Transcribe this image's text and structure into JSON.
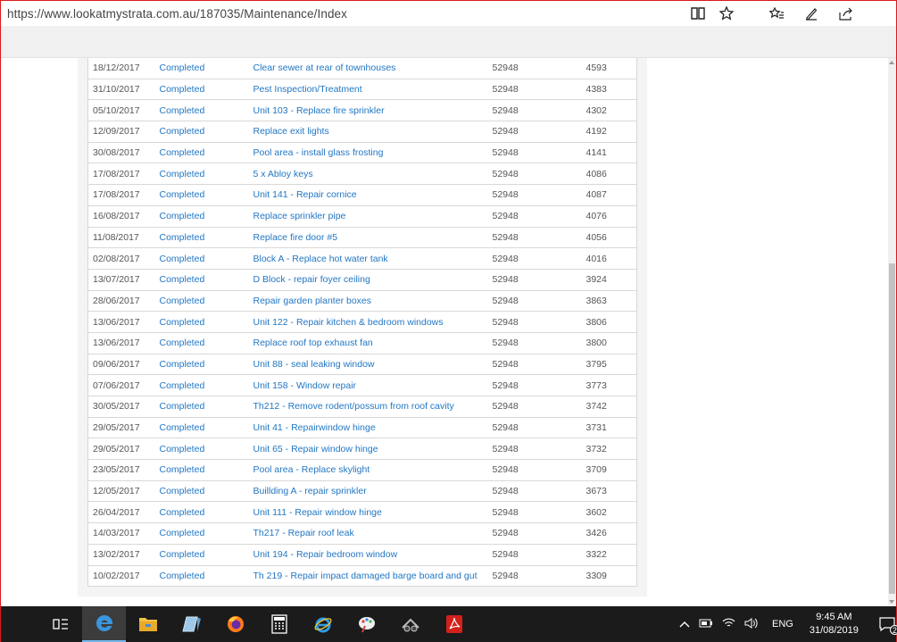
{
  "browser": {
    "url": "https://www.lookatmystrata.com.au/187035/Maintenance/Index",
    "icons": [
      "reading-view-icon",
      "favorite-star-icon",
      "favorites-hub-icon",
      "pen-note-icon",
      "share-icon"
    ]
  },
  "maintenance": {
    "rows": [
      {
        "date": "18/12/2017",
        "status": "Completed",
        "description": "Clear sewer at rear of townhouses",
        "number": "52948",
        "id": "4593"
      },
      {
        "date": "31/10/2017",
        "status": "Completed",
        "description": "Pest Inspection/Treatment",
        "number": "52948",
        "id": "4383"
      },
      {
        "date": "05/10/2017",
        "status": "Completed",
        "description": "Unit 103 - Replace fire sprinkler",
        "number": "52948",
        "id": "4302"
      },
      {
        "date": "12/09/2017",
        "status": "Completed",
        "description": "Replace exit lights",
        "number": "52948",
        "id": "4192"
      },
      {
        "date": "30/08/2017",
        "status": "Completed",
        "description": "Pool area - install glass frosting",
        "number": "52948",
        "id": "4141"
      },
      {
        "date": "17/08/2017",
        "status": "Completed",
        "description": "5 x Abloy keys",
        "number": "52948",
        "id": "4086"
      },
      {
        "date": "17/08/2017",
        "status": "Completed",
        "description": "Unit 141 - Repair cornice",
        "number": "52948",
        "id": "4087"
      },
      {
        "date": "16/08/2017",
        "status": "Completed",
        "description": "Replace sprinkler pipe",
        "number": "52948",
        "id": "4076"
      },
      {
        "date": "11/08/2017",
        "status": "Completed",
        "description": "Replace fire door #5",
        "number": "52948",
        "id": "4056"
      },
      {
        "date": "02/08/2017",
        "status": "Completed",
        "description": "Block A - Replace hot water tank",
        "number": "52948",
        "id": "4016"
      },
      {
        "date": "13/07/2017",
        "status": "Completed",
        "description": "D Block - repair foyer ceiling",
        "number": "52948",
        "id": "3924"
      },
      {
        "date": "28/06/2017",
        "status": "Completed",
        "description": "Repair garden planter boxes",
        "number": "52948",
        "id": "3863"
      },
      {
        "date": "13/06/2017",
        "status": "Completed",
        "description": "Unit 122 - Repair kitchen & bedroom windows",
        "number": "52948",
        "id": "3806"
      },
      {
        "date": "13/06/2017",
        "status": "Completed",
        "description": "Replace roof top exhaust fan",
        "number": "52948",
        "id": "3800"
      },
      {
        "date": "09/06/2017",
        "status": "Completed",
        "description": "Unit 88 - seal leaking window",
        "number": "52948",
        "id": "3795"
      },
      {
        "date": "07/06/2017",
        "status": "Completed",
        "description": "Unit 158 - Window repair",
        "number": "52948",
        "id": "3773"
      },
      {
        "date": "30/05/2017",
        "status": "Completed",
        "description": "Th212 - Remove rodent/possum from roof cavity",
        "number": "52948",
        "id": "3742"
      },
      {
        "date": "29/05/2017",
        "status": "Completed",
        "description": "Unit 41 - Repairwindow hinge",
        "number": "52948",
        "id": "3731"
      },
      {
        "date": "29/05/2017",
        "status": "Completed",
        "description": "Unit 65 - Repair window hinge",
        "number": "52948",
        "id": "3732"
      },
      {
        "date": "23/05/2017",
        "status": "Completed",
        "description": "Pool area - Replace skylight",
        "number": "52948",
        "id": "3709"
      },
      {
        "date": "12/05/2017",
        "status": "Completed",
        "description": "Buillding A - repair sprinkler",
        "number": "52948",
        "id": "3673"
      },
      {
        "date": "26/04/2017",
        "status": "Completed",
        "description": "Unit 111 - Repair window hinge",
        "number": "52948",
        "id": "3602"
      },
      {
        "date": "14/03/2017",
        "status": "Completed",
        "description": "Th217 - Repair roof leak",
        "number": "52948",
        "id": "3426"
      },
      {
        "date": "13/02/2017",
        "status": "Completed",
        "description": "Unit 194 - Repair bedroom window",
        "number": "52948",
        "id": "3322"
      },
      {
        "date": "10/02/2017",
        "status": "Completed",
        "description": "Th 219 - Repair impact damaged barge board and gut",
        "number": "52948",
        "id": "3309"
      }
    ]
  },
  "taskbar": {
    "apps": [
      "task-view-icon",
      "edge-icon",
      "file-explorer-icon",
      "notepad-icon",
      "firefox-icon",
      "calculator-icon",
      "internet-explorer-icon",
      "paint-icon",
      "snipping-tool-icon",
      "acrobat-icon"
    ],
    "language": "ENG",
    "time": "9:45 AM",
    "date": "31/08/2019",
    "notification_count": "2"
  }
}
